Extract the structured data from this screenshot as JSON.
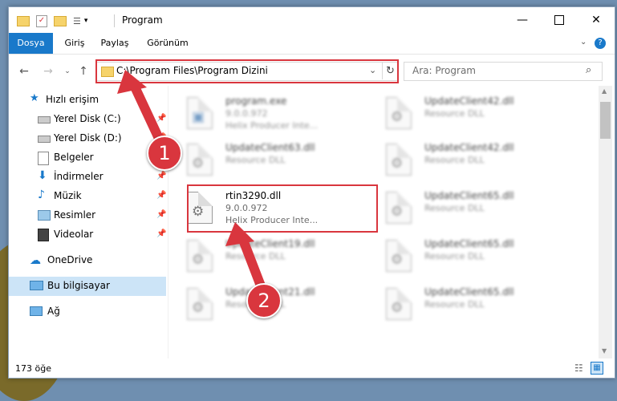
{
  "window": {
    "title": "Program"
  },
  "ribbon": {
    "tabs": [
      "Dosya",
      "Giriş",
      "Paylaş",
      "Görünüm"
    ]
  },
  "address": {
    "path": "C:\\Program Files\\Program Dizini"
  },
  "search": {
    "placeholder": "Ara: Program"
  },
  "sidebar": {
    "items": [
      {
        "label": "Hızlı erişim",
        "icon": "star-icon"
      },
      {
        "label": "Yerel Disk (C:)",
        "icon": "drive-icon",
        "pinned": true
      },
      {
        "label": "Yerel Disk (D:)",
        "icon": "drive-icon",
        "pinned": true
      },
      {
        "label": "Belgeler",
        "icon": "documents-icon",
        "pinned": true
      },
      {
        "label": "İndirmeler",
        "icon": "download-icon",
        "pinned": true
      },
      {
        "label": "Müzik",
        "icon": "music-icon",
        "pinned": true
      },
      {
        "label": "Resimler",
        "icon": "pictures-icon",
        "pinned": true
      },
      {
        "label": "Videolar",
        "icon": "videos-icon",
        "pinned": true
      },
      {
        "label": "OneDrive",
        "icon": "cloud-icon"
      },
      {
        "label": "Bu bilgisayar",
        "icon": "computer-icon",
        "selected": true
      },
      {
        "label": "Ağ",
        "icon": "network-icon"
      }
    ]
  },
  "files": {
    "left": [
      {
        "name": "program.exe",
        "detail1": "9.0.0.972",
        "detail2": "Helix Producer Inte..."
      },
      {
        "name": "UpdateClient63.dll",
        "detail1": "Resource DLL"
      },
      {
        "name": "rtin3290.dll",
        "detail1": "9.0.0.972",
        "detail2": "Helix Producer Inte..."
      },
      {
        "name": "UpdateClient19.dll",
        "detail1": "Resource DLL"
      },
      {
        "name": "UpdateClient21.dll",
        "detail1": "Resource DLL"
      }
    ],
    "right": [
      {
        "name": "UpdateClient42.dll",
        "detail1": "Resource DLL"
      },
      {
        "name": "UpdateClient42.dll",
        "detail1": "Resource DLL"
      },
      {
        "name": "UpdateClient65.dll",
        "detail1": "Resource DLL"
      },
      {
        "name": "UpdateClient65.dll",
        "detail1": "Resource DLL"
      },
      {
        "name": "UpdateClient65.dll",
        "detail1": "Resource DLL"
      }
    ]
  },
  "status": {
    "count": "173 öğe"
  },
  "annotations": {
    "step1": "1",
    "step2": "2",
    "color": "#d9363e"
  }
}
